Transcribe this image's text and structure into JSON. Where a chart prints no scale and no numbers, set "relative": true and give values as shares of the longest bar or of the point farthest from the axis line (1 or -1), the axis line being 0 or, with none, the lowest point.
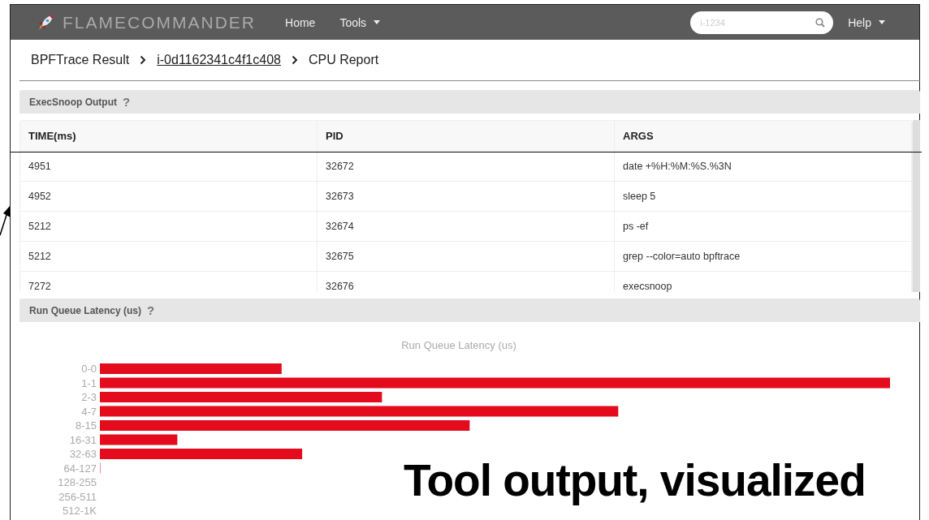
{
  "navbar": {
    "brand": "FLAMECOMMANDER",
    "links": [
      {
        "label": "Home",
        "dropdown": false
      },
      {
        "label": "Tools",
        "dropdown": true
      }
    ],
    "search": {
      "placeholder": "i-1234"
    },
    "help": {
      "label": "Help",
      "dropdown": true
    }
  },
  "breadcrumb": [
    {
      "label": "BPFTrace Result",
      "link": false
    },
    {
      "label": "i-0d1162341c4f1c408",
      "link": true
    },
    {
      "label": "CPU Report",
      "link": false
    }
  ],
  "execsnoop": {
    "title": "ExecSnoop Output",
    "help": "?",
    "table": {
      "columns": [
        "TIME(ms)",
        "PID",
        "ARGS"
      ],
      "rows": [
        [
          "4951",
          "32672",
          "date +%H:%M:%S.%3N"
        ],
        [
          "4952",
          "32673",
          "sleep 5"
        ],
        [
          "5212",
          "32674",
          "ps -ef"
        ],
        [
          "5212",
          "32675",
          "grep --color=auto bpftrace"
        ],
        [
          "7272",
          "32676",
          "execsnoop"
        ]
      ]
    }
  },
  "latency": {
    "title": "Run Queue Latency (us)",
    "help": "?",
    "chart_data": {
      "type": "bar",
      "orientation": "horizontal",
      "title": "Run Queue Latency (us)",
      "categories": [
        "0-0",
        "1-1",
        "2-3",
        "4-7",
        "8-15",
        "16-31",
        "32-63",
        "64-127",
        "128-255",
        "256-511",
        "512-1K"
      ],
      "relative": true,
      "series": [
        {
          "color": "#e30b1c",
          "values": [
            0.23,
            1,
            0.357,
            0.656,
            0.468,
            0.098,
            0.256,
            0.001,
            0,
            0,
            0
          ]
        }
      ]
    }
  },
  "caption": "Tool output, visualized"
}
